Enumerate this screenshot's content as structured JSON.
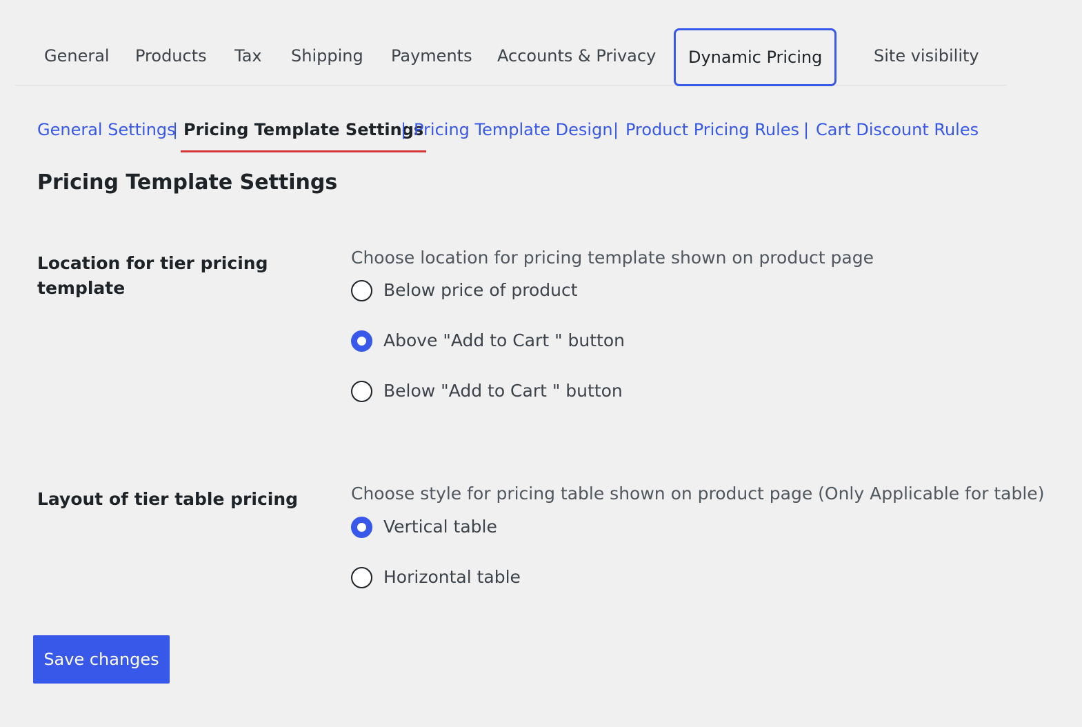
{
  "top_tabs": [
    {
      "label": "General"
    },
    {
      "label": "Products"
    },
    {
      "label": "Tax"
    },
    {
      "label": "Shipping"
    },
    {
      "label": "Payments"
    },
    {
      "label": "Accounts & Privacy"
    },
    {
      "label": "Dynamic Pricing",
      "active": true
    },
    {
      "label": "Site visibility"
    }
  ],
  "sub_nav": {
    "items": [
      {
        "label": "General Settings"
      },
      {
        "label": "Pricing Template Settings",
        "current": true
      },
      {
        "label": "Pricing Template Design"
      },
      {
        "label": "Product Pricing Rules"
      },
      {
        "label": "Cart Discount Rules"
      }
    ],
    "separator": "|"
  },
  "page_title": "Pricing Template Settings",
  "location_field": {
    "label": "Location for tier pricing template",
    "description": "Choose location for pricing template shown on product page",
    "options": [
      {
        "label": "Below price of product",
        "checked": false
      },
      {
        "label": "Above \"Add to Cart \" button",
        "checked": true
      },
      {
        "label": "Below \"Add to Cart \" button",
        "checked": false
      }
    ]
  },
  "layout_field": {
    "label": "Layout of tier table pricing",
    "description": "Choose style for pricing table shown on product page (Only Applicable for table)",
    "options": [
      {
        "label": "Vertical table",
        "checked": true
      },
      {
        "label": "Horizontal table",
        "checked": false
      }
    ]
  },
  "save_button": {
    "label": "Save changes"
  },
  "colors": {
    "accent": "#3858e9",
    "active_underline": "#d63638",
    "background": "#f0f0f1"
  }
}
